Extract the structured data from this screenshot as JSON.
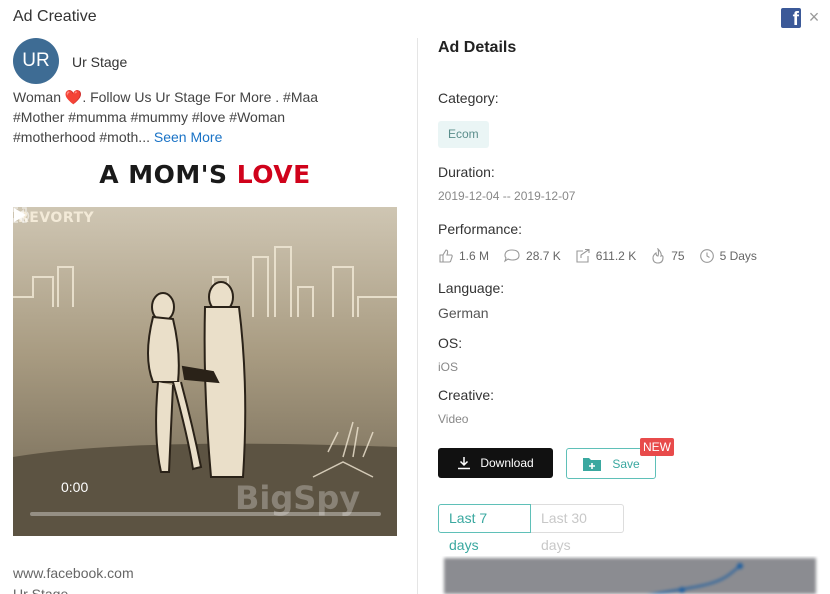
{
  "modal": {
    "title": "Ad Creative"
  },
  "advertiser": {
    "avatar_initials": "UR",
    "name": "Ur Stage",
    "avatar_color": "#3e6c94"
  },
  "ad": {
    "text_before_heart": "Woman ",
    "heart": "❤️",
    "text_after_heart": ". Follow Us Ur Stage For More . #Maa #Mother #mumma #mummy #love #Woman #motherhood #moth...",
    "see_more_label": "Seen More",
    "video_title_main": "A MOM'S ",
    "video_title_accent": "LOVE",
    "video_watermark_channel": "REVORTY",
    "video_watermark_site": "BigSpy",
    "video_time": "0:00",
    "video_progress": 0,
    "landing_url": "www.facebook.com",
    "landing_name": "Ur Stage"
  },
  "details": {
    "title": "Ad Details",
    "category_label": "Category:",
    "category_value": "Ecom",
    "duration_label": "Duration:",
    "duration_value": "2019-12-04 -- 2019-12-07",
    "performance_label": "Performance:",
    "performance": {
      "likes": "1.6 M",
      "comments": "28.7 K",
      "shares": "611.2 K",
      "heat": "75",
      "days": "5 Days"
    },
    "language_label": "Language:",
    "language_value": "German",
    "os_label": "OS:",
    "os_value": "iOS",
    "creative_label": "Creative:",
    "creative_value": "Video"
  },
  "actions": {
    "download_label": "Download",
    "save_label": "Save",
    "new_badge": "NEW"
  },
  "ranges": {
    "active": "Last 7 days",
    "inactive": "Last 30 days"
  },
  "colors": {
    "accent": "#3aa8a0",
    "facebook": "#3b5998",
    "badge": "#e84b4b",
    "heart": "#d0021b"
  }
}
